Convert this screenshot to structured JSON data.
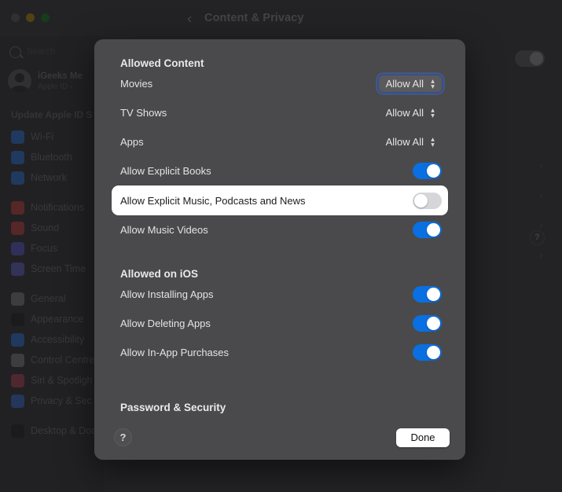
{
  "window": {
    "title": "Content & Privacy",
    "back_icon": "chevron-left-icon",
    "traffic_lights": [
      "close",
      "minimize",
      "zoom"
    ]
  },
  "sidebar": {
    "search": {
      "placeholder": "Search",
      "icon": "search-icon"
    },
    "account": {
      "name": "iGeeks Me",
      "subtitle": "Apple ID",
      "avatar": "user-avatar"
    },
    "update_banner": "Update Apple ID S",
    "items": [
      {
        "label": "Wi-Fi",
        "icon": "wifi-icon",
        "color": "#2b7ff5",
        "gap": false
      },
      {
        "label": "Bluetooth",
        "icon": "bluetooth-icon",
        "color": "#2b7ff5",
        "gap": false
      },
      {
        "label": "Network",
        "icon": "network-icon",
        "color": "#2b7ff5",
        "gap": false
      },
      {
        "label": "Notifications",
        "icon": "notifications-icon",
        "color": "#e0443e",
        "gap": true
      },
      {
        "label": "Sound",
        "icon": "sound-icon",
        "color": "#e0443e",
        "gap": false
      },
      {
        "label": "Focus",
        "icon": "focus-icon",
        "color": "#5e5ce6",
        "gap": false
      },
      {
        "label": "Screen Time",
        "icon": "screen-time-icon",
        "color": "#6e6ae8",
        "gap": false
      },
      {
        "label": "General",
        "icon": "general-icon",
        "color": "#8e8e93",
        "gap": true
      },
      {
        "label": "Appearance",
        "icon": "appearance-icon",
        "color": "#1c1c1e",
        "gap": false
      },
      {
        "label": "Accessibility",
        "icon": "accessibility-icon",
        "color": "#2b7ff5",
        "gap": false
      },
      {
        "label": "Control Centre",
        "icon": "control-centre-icon",
        "color": "#8e8e93",
        "gap": false
      },
      {
        "label": "Siri & Spotligh",
        "icon": "siri-icon",
        "color": "#c8435a",
        "gap": false
      },
      {
        "label": "Privacy & Sec",
        "icon": "privacy-icon",
        "color": "#3b74e8",
        "gap": false
      },
      {
        "label": "Desktop & Doc",
        "icon": "desktop-dock-icon",
        "color": "#1c1c1e",
        "gap": true
      }
    ]
  },
  "background_content": {
    "toggle_on": false,
    "help_icon": "question-mark-icon",
    "chevrons": [
      "chevron-right-icon",
      "chevron-right-icon",
      "chevron-right-icon",
      "chevron-right-icon"
    ]
  },
  "sheet": {
    "sections": [
      {
        "title": "Allowed Content",
        "rows": [
          {
            "type": "popup",
            "label": "Movies",
            "value": "Allow All",
            "bordered": true,
            "focused": true
          },
          {
            "type": "popup",
            "label": "TV Shows",
            "value": "Allow All",
            "bordered": false,
            "focused": false
          },
          {
            "type": "popup",
            "label": "Apps",
            "value": "Allow All",
            "bordered": false,
            "focused": false
          },
          {
            "type": "switch",
            "label": "Allow Explicit Books",
            "on": true,
            "highlight": false
          },
          {
            "type": "switch",
            "label": "Allow Explicit Music, Podcasts and News",
            "on": false,
            "highlight": true
          },
          {
            "type": "switch",
            "label": "Allow Music Videos",
            "on": true,
            "highlight": false
          }
        ]
      },
      {
        "title": "Allowed on iOS",
        "rows": [
          {
            "type": "switch",
            "label": "Allow Installing Apps",
            "on": true,
            "highlight": false
          },
          {
            "type": "switch",
            "label": "Allow Deleting Apps",
            "on": true,
            "highlight": false
          },
          {
            "type": "switch",
            "label": "Allow In-App Purchases",
            "on": true,
            "highlight": false
          }
        ]
      }
    ],
    "cutoff_section_title": "Password & Security",
    "footer": {
      "help_label": "?",
      "help_icon": "question-mark-icon",
      "done_label": "Done"
    }
  }
}
